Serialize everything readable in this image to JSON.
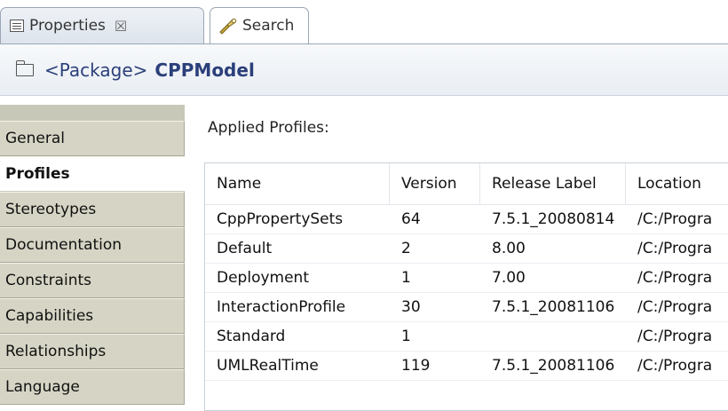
{
  "tabs": [
    {
      "label": "Properties",
      "icon": "properties-view-icon",
      "close": "☒"
    },
    {
      "label": "Search",
      "icon": "search-flashlight-icon"
    }
  ],
  "title": {
    "kind": "<Package>",
    "name": "CPPModel"
  },
  "sidebar": {
    "items": [
      {
        "label": "General"
      },
      {
        "label": "Profiles",
        "active": true
      },
      {
        "label": "Stereotypes"
      },
      {
        "label": "Documentation"
      },
      {
        "label": "Constraints"
      },
      {
        "label": "Capabilities"
      },
      {
        "label": "Relationships"
      },
      {
        "label": "Language"
      }
    ]
  },
  "main": {
    "section_label": "Applied Profiles:",
    "table": {
      "columns": [
        "Name",
        "Version",
        "Release Label",
        "Location"
      ],
      "rows": [
        [
          "CppPropertySets",
          "64",
          "7.5.1_20080814",
          "/C:/Progra"
        ],
        [
          "Default",
          "2",
          "8.00",
          "/C:/Progra"
        ],
        [
          "Deployment",
          "1",
          "7.00",
          "/C:/Progra"
        ],
        [
          "InteractionProfile",
          "30",
          "7.5.1_20081106",
          "/C:/Progra"
        ],
        [
          "Standard",
          "1",
          "",
          "/C:/Progra"
        ],
        [
          "UMLRealTime",
          "119",
          "7.5.1_20081106",
          "/C:/Progra"
        ]
      ]
    }
  },
  "colors": {
    "title_text": "#2b3f7a",
    "sidebar_tab_bg": "#d6d5c5",
    "active_tab_bg": "#ffffff"
  }
}
